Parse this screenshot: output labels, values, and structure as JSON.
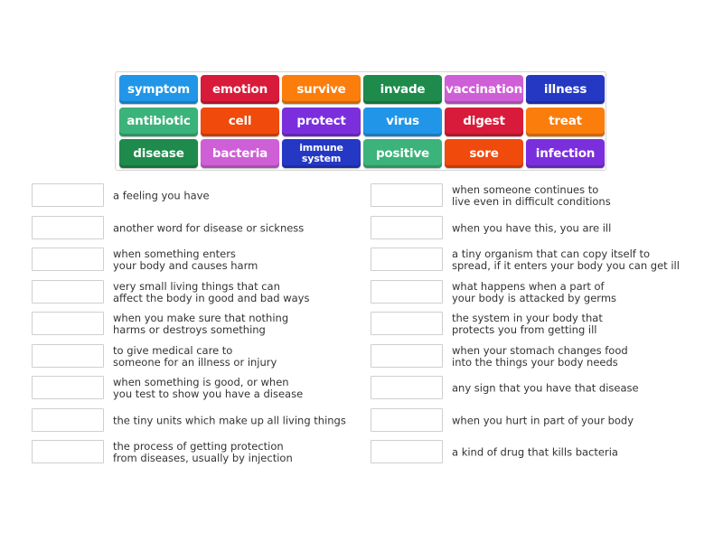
{
  "word_bank": {
    "tiles": [
      {
        "label": "symptom",
        "color": "#2196e8"
      },
      {
        "label": "emotion",
        "color": "#d81b3a"
      },
      {
        "label": "survive",
        "color": "#fb7d0c"
      },
      {
        "label": "invade",
        "color": "#1e8a4c"
      },
      {
        "label": "vaccination",
        "color": "#cf5fd6"
      },
      {
        "label": "illness",
        "color": "#2438c4"
      },
      {
        "label": "antibiotic",
        "color": "#3bb37a"
      },
      {
        "label": "cell",
        "color": "#f04a0c"
      },
      {
        "label": "protect",
        "color": "#7b2fdc"
      },
      {
        "label": "virus",
        "color": "#2196e8"
      },
      {
        "label": "digest",
        "color": "#d81b3a"
      },
      {
        "label": "treat",
        "color": "#fb7d0c"
      },
      {
        "label": "disease",
        "color": "#1e8a4c"
      },
      {
        "label": "bacteria",
        "color": "#cf5fd6"
      },
      {
        "label": "immune system",
        "color": "#2438c4"
      },
      {
        "label": "positive",
        "color": "#3bb37a"
      },
      {
        "label": "sore",
        "color": "#f04a0c"
      },
      {
        "label": "infection",
        "color": "#7b2fdc"
      }
    ]
  },
  "clues_left": [
    "a feeling you have",
    "another word for disease or sickness",
    "when something enters\nyour body and causes harm",
    "very small living things that can\naffect the body in good and bad ways",
    "when you make sure that nothing\nharms or destroys something",
    "to give medical care to\nsomeone for an illness or injury",
    "when something is good, or when\nyou test to show you have a disease",
    "the tiny units which make up all living things",
    "the process of getting protection\nfrom diseases, usually by injection"
  ],
  "clues_right": [
    "when someone continues to\nlive even in difficult conditions",
    "when you have this, you are ill",
    "a tiny organism that can copy itself to\nspread, if it enters your body you can get ill",
    "what happens when a part of\nyour body is attacked by germs",
    "the system in your body that\nprotects you from getting ill",
    "when your stomach changes food\ninto the things your body needs",
    "any sign that you have that disease",
    "when you hurt in part of your body",
    "a kind of drug that kills bacteria"
  ]
}
